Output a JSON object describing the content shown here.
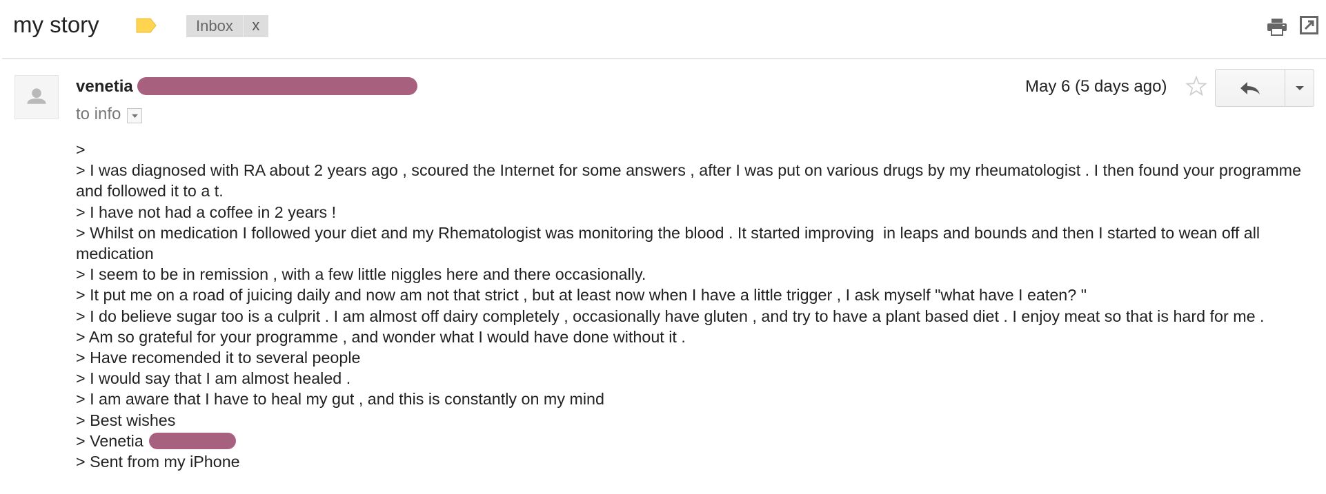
{
  "thread": {
    "subject": "my story",
    "label_icon": "label-tag-icon",
    "label_color": "#ffd54f",
    "label_chip": {
      "label": "Inbox",
      "remove_label": "x"
    },
    "actions": {
      "print_icon": "print-icon",
      "new_window_icon": "new-window-icon"
    }
  },
  "message": {
    "avatar_icon": "default-avatar-icon",
    "sender_name": "venetia",
    "redaction_color": "#a8607f",
    "recipient_text": "to info",
    "details_icon": "chevron-down-icon",
    "date": "May 6 (5 days ago)",
    "star_icon": "star-outline-icon",
    "reply_icon": "reply-icon",
    "more_icon": "caret-down-icon",
    "body_lines": [
      ">",
      "> I was diagnosed with RA about 2 years ago , scoured the Internet for some answers , after I was put on various drugs by my rheumatologist . I then found your programme and followed it to a t.",
      "> I have not had a coffee in 2 years !",
      "> Whilst on medication I followed your diet and my Rhematologist was monitoring the blood . It started improving  in leaps and bounds and then I started to wean off all medication",
      "> I seem to be in remission , with a few little niggles here and there occasionally.",
      "> It put me on a road of juicing daily and now am not that strict , but at least now when I have a little trigger , I ask myself \"what have I eaten? \"",
      "> I do believe sugar too is a culprit . I am almost off dairy completely , occasionally have gluten , and try to have a plant based diet . I enjoy meat so that is hard for me .",
      "> Am so grateful for your programme , and wonder what I would have done without it .",
      "> Have recomended it to several people",
      "> I would say that I am almost healed .",
      "> I am aware that I have to heal my gut , and this is constantly on my mind",
      "> Best wishes"
    ],
    "signature_line": "> Venetia",
    "closing_line": "> Sent from my iPhone"
  }
}
